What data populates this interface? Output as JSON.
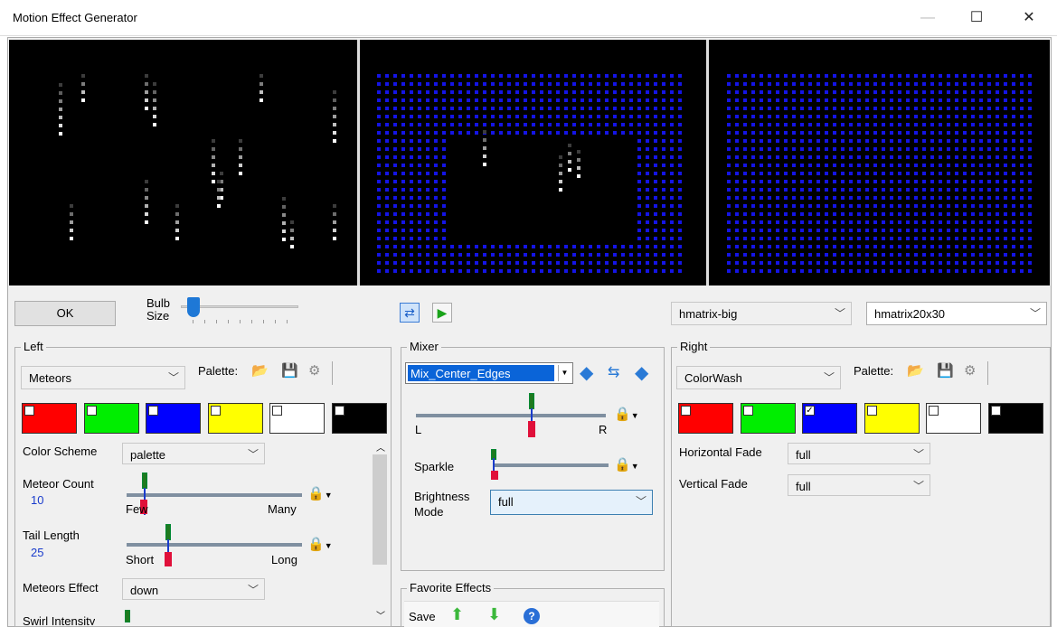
{
  "window": {
    "title": "Motion Effect Generator",
    "min_icon": "minimize-icon",
    "max_icon": "maximize-icon",
    "close_icon": "close-icon"
  },
  "toolbar": {
    "ok_label": "OK",
    "bulb_size_label": "Bulb\nSize",
    "model1": "hmatrix-big",
    "model2": "hmatrix20x30"
  },
  "left": {
    "group_label": "Left",
    "effect": "Meteors",
    "palette_label": "Palette:",
    "swatches": [
      "#ff0000",
      "#00ee00",
      "#0000ff",
      "#ffff00",
      "#ffffff",
      "#000000"
    ],
    "color_scheme_label": "Color Scheme",
    "color_scheme_value": "palette",
    "meteor_count_label": "Meteor Count",
    "meteor_count_value": "10",
    "few_label": "Few",
    "many_label": "Many",
    "tail_length_label": "Tail Length",
    "tail_length_value": "25",
    "short_label": "Short",
    "long_label": "Long",
    "meteors_effect_label": "Meteors Effect",
    "meteors_effect_value": "down",
    "swirl_label": "Swirl Intensity"
  },
  "mixer": {
    "group_label": "Mixer",
    "mix_value": "Mix_Center_Edges",
    "l_label": "L",
    "r_label": "R",
    "sparkle_label": "Sparkle",
    "brightness_label": "Brightness\nMode",
    "brightness_value": "full"
  },
  "favorites": {
    "group_label": "Favorite Effects",
    "save_label": "Save"
  },
  "right": {
    "group_label": "Right",
    "effect": "ColorWash",
    "palette_label": "Palette:",
    "swatches": [
      "#ff0000",
      "#00ee00",
      "#0000ff",
      "#ffff00",
      "#ffffff",
      "#000000"
    ],
    "h_fade_label": "Horizontal Fade",
    "h_fade_value": "full",
    "v_fade_label": "Vertical Fade",
    "v_fade_value": "full"
  }
}
